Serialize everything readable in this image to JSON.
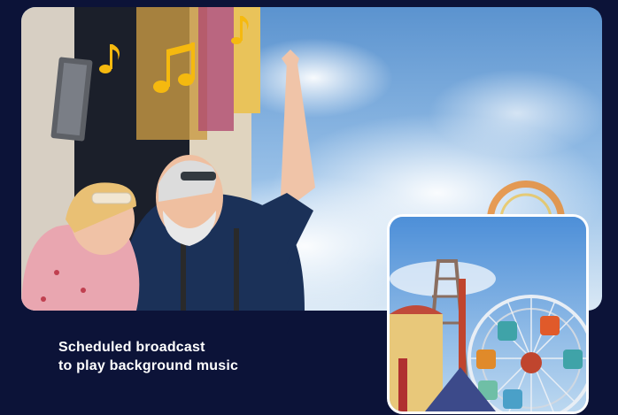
{
  "caption": {
    "line1": "Scheduled broadcast",
    "line2": "to play background music"
  },
  "hero": {
    "icons": [
      "music-note-icon",
      "double-music-note-icon",
      "music-note-icon"
    ],
    "note_color": "#f5b90f"
  },
  "colors": {
    "background": "#0c1338",
    "caption_text": "#ffffff",
    "inset_border": "#ffffff"
  }
}
